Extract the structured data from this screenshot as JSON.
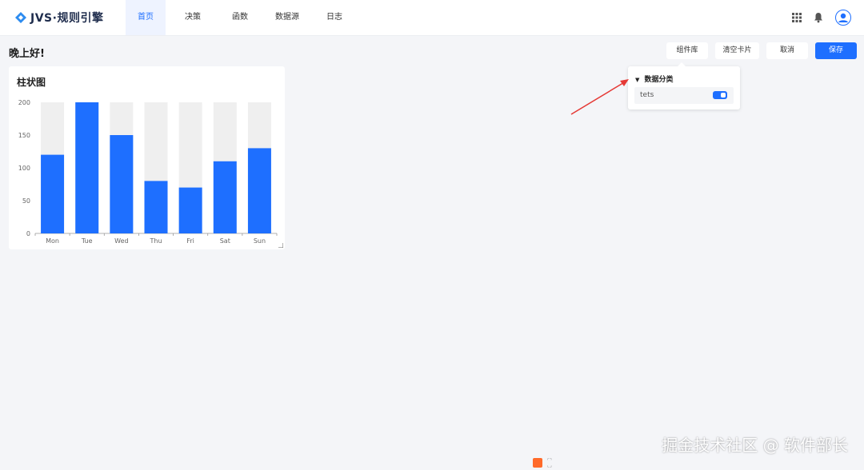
{
  "app": {
    "brand": "JVS·规则引擎"
  },
  "nav": {
    "items": [
      "首页",
      "决策",
      "函数",
      "数据源",
      "日志"
    ],
    "active": 0
  },
  "header": {
    "icons": [
      "apps-grid-icon",
      "bell-icon",
      "user-avatar-icon"
    ]
  },
  "page": {
    "greeting": "晚上好!"
  },
  "actions": {
    "library": "组件库",
    "clear": "清空卡片",
    "cancel": "取消",
    "save": "保存"
  },
  "panel": {
    "title": "数据分类",
    "row_label": "tets",
    "toggle_on": true
  },
  "card": {
    "title": "柱状图"
  },
  "chart_data": {
    "type": "bar",
    "title": "柱状图",
    "categories": [
      "Mon",
      "Tue",
      "Wed",
      "Thu",
      "Fri",
      "Sat",
      "Sun"
    ],
    "values": [
      120,
      200,
      150,
      80,
      70,
      110,
      130
    ],
    "background_max": 200,
    "ylim": [
      0,
      200
    ],
    "yticks": [
      0,
      50,
      100,
      150,
      200
    ],
    "xlabel": "",
    "ylabel": "",
    "grid": false,
    "colors": {
      "bar": "#1e6fff",
      "background": "#efefef"
    }
  },
  "watermark": "掘金技术社区 @ 软件部长",
  "colors": {
    "accent": "#1e6fff",
    "annotation_arrow": "#e53935"
  }
}
